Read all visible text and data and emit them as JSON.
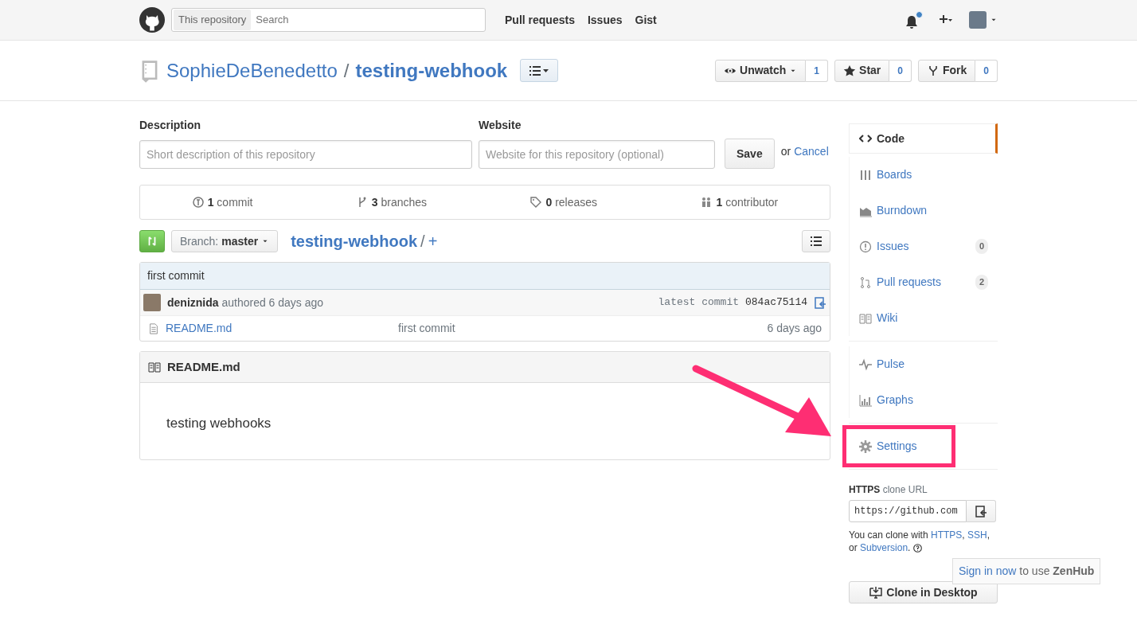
{
  "header": {
    "search_scope": "This repository",
    "search_placeholder": "Search",
    "nav": [
      "Pull requests",
      "Issues",
      "Gist"
    ],
    "notifications_unread": true
  },
  "repo": {
    "owner": "SophieDeBenedetto",
    "separator": "/",
    "name": "testing-webhook",
    "actions": [
      {
        "kind": "watch",
        "label": "Unwatch",
        "count": "1"
      },
      {
        "kind": "star",
        "label": "Star",
        "count": "0"
      },
      {
        "kind": "fork",
        "label": "Fork",
        "count": "0"
      }
    ]
  },
  "edit_form": {
    "description_label": "Description",
    "description_placeholder": "Short description of this repository",
    "website_label": "Website",
    "website_placeholder": "Website for this repository (optional)",
    "save": "Save",
    "or": "or",
    "cancel": "Cancel"
  },
  "stats": [
    {
      "kind": "commit",
      "count": "1",
      "label": "commit"
    },
    {
      "kind": "branch",
      "count": "3",
      "label": "branches"
    },
    {
      "kind": "tag",
      "count": "0",
      "label": "releases"
    },
    {
      "kind": "people",
      "count": "1",
      "label": "contributor"
    }
  ],
  "branch_bar": {
    "branch_label": "Branch:",
    "branch": "master",
    "path_repo": "testing-webhook",
    "path_separator": "/",
    "add": "+"
  },
  "commit": {
    "message": "first commit",
    "author": "deniznida",
    "meta": "authored 6 days ago",
    "latest_label": "latest commit",
    "sha": "084ac75114"
  },
  "files": [
    {
      "name": "README.md",
      "message": "first commit",
      "age": "6 days ago"
    }
  ],
  "readme": {
    "title": "README.md",
    "body": "testing webhooks"
  },
  "sidebar": {
    "groups": [
      [
        {
          "kind": "code",
          "label": "Code",
          "selected": true,
          "highlighted": false
        },
        {
          "kind": "boards",
          "label": "Boards",
          "selected": false,
          "highlighted": false
        },
        {
          "kind": "burndown",
          "label": "Burndown",
          "selected": false,
          "highlighted": false
        },
        {
          "kind": "issues",
          "label": "Issues",
          "count": "0",
          "selected": false,
          "highlighted": false
        },
        {
          "kind": "pulls",
          "label": "Pull requests",
          "count": "2",
          "selected": false,
          "highlighted": false
        },
        {
          "kind": "wiki",
          "label": "Wiki",
          "selected": false,
          "highlighted": false
        }
      ],
      [
        {
          "kind": "pulse",
          "label": "Pulse",
          "selected": false,
          "highlighted": false
        },
        {
          "kind": "graphs",
          "label": "Graphs",
          "selected": false,
          "highlighted": false
        }
      ],
      [
        {
          "kind": "settings",
          "label": "Settings",
          "selected": false,
          "highlighted": true
        }
      ]
    ]
  },
  "clone": {
    "protocol": "HTTPS",
    "label": "clone URL",
    "url": "https://github.com",
    "help": [
      {
        "text": "You can clone with ",
        "link": false
      },
      {
        "text": "HTTPS",
        "link": true
      },
      {
        "text": ", ",
        "link": false
      },
      {
        "text": "SSH",
        "link": true
      },
      {
        "text": ", or ",
        "link": false
      },
      {
        "text": "Subversion",
        "link": true
      },
      {
        "text": ".",
        "link": false
      }
    ],
    "desktop_button": "Clone in Desktop"
  },
  "zenhub_tooltip": {
    "link": "Sign in now",
    "text": " to use ",
    "brand": "ZenHub"
  }
}
